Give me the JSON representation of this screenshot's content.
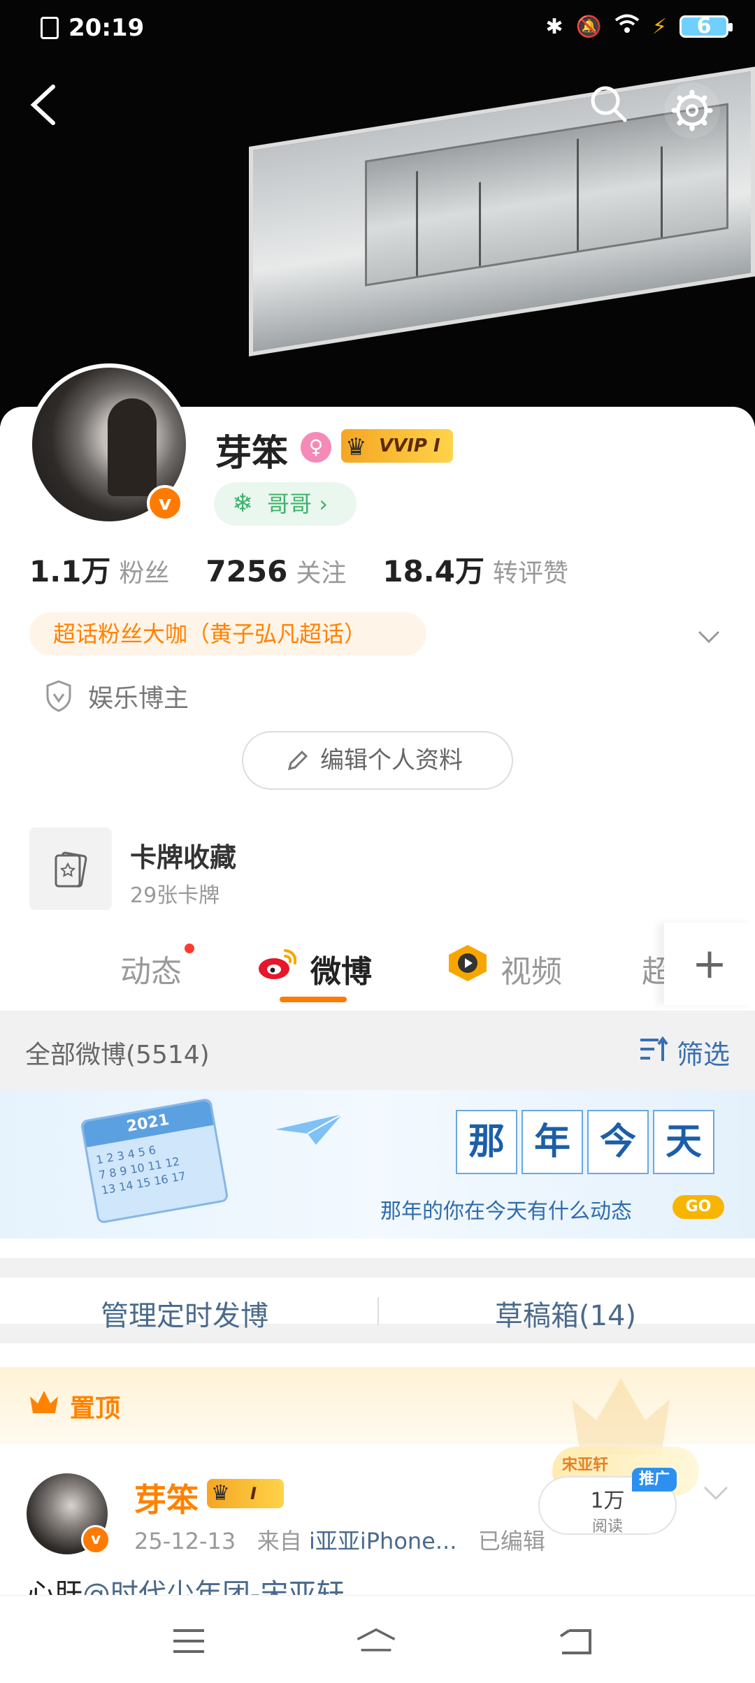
{
  "status": {
    "time": "20:19",
    "battery": "6"
  },
  "profile": {
    "name": "芽笨",
    "vip_label": "VVIP I",
    "tag": "哥哥",
    "verified_letter": "v",
    "stats": [
      {
        "value": "1.1万",
        "label": "粉丝"
      },
      {
        "value": "7256",
        "label": "关注"
      },
      {
        "value": "18.4万",
        "label": "转评赞"
      }
    ],
    "fan_badge": "超话粉丝大咖（黄子弘凡超话）",
    "role": "娱乐博主",
    "edit_button": "编辑个人资料"
  },
  "cards": {
    "title": "卡牌收藏",
    "subtitle": "29张卡牌"
  },
  "tabs": {
    "items": [
      "动态",
      "微博",
      "视频",
      "超"
    ],
    "active": "微博"
  },
  "filter": {
    "count_label": "全部微博(5514)",
    "filter_label": "筛选"
  },
  "banner": {
    "year": "2021",
    "title_chars": [
      "那",
      "年",
      "今",
      "天"
    ],
    "subtitle": "那年的你在今天有什么动态",
    "go": "GO"
  },
  "manage": {
    "schedule": "管理定时发博",
    "drafts": "草稿箱(14)"
  },
  "pinned": {
    "label": "置顶"
  },
  "post": {
    "name": "芽笨",
    "vip": "I",
    "date": "25-12-13",
    "source_prefix": "来自",
    "source": "i亚亚iPhone...",
    "edited": "已编辑",
    "text_prefix": "心肝",
    "text_mention": "@时代少年团-宋亚轩",
    "reads_value": "1万",
    "reads_label": "阅读",
    "ad_label": "推广",
    "promo_text": "宋亚轩"
  },
  "colors": {
    "accent": "#ff8200",
    "link": "#4a6a8c",
    "tab_underline": "#ff7a00"
  }
}
